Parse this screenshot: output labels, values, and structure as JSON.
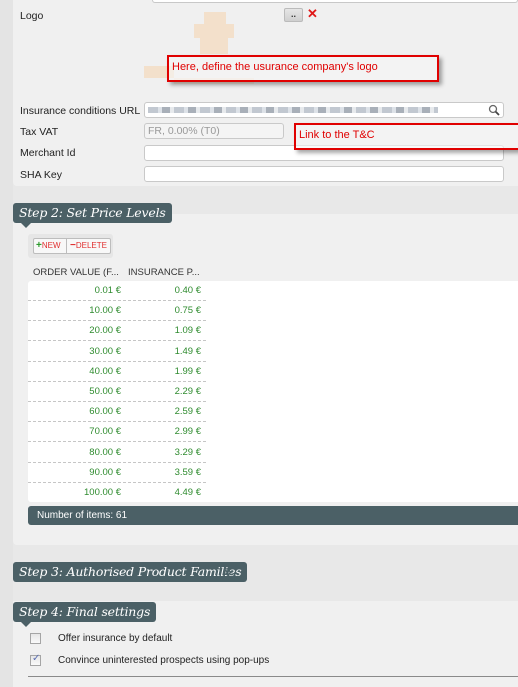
{
  "step1": {
    "logo_label": "Logo",
    "browse_label": "..",
    "remove_label": "✕",
    "insurance_url_label": "Insurance conditions URL",
    "tax_vat_label": "Tax VAT",
    "tax_vat_value": "FR, 0.00% (T0)",
    "merchant_id_label": "Merchant Id",
    "merchant_id_value": "",
    "sha_key_label": "SHA Key",
    "sha_key_value": ""
  },
  "annotations": {
    "logo_callout": "Here, define the usurance company's logo",
    "tc_callout": "Link to the T&C"
  },
  "step2": {
    "title": "Step 2: Set Price Levels",
    "new_label": "NEW",
    "delete_label": "DELETE",
    "columns": [
      "ORDER VALUE (F...",
      "INSURANCE P..."
    ],
    "rows": [
      [
        "0.01 €",
        "0.40 €"
      ],
      [
        "10.00 €",
        "0.75 €"
      ],
      [
        "20.00 €",
        "1.09 €"
      ],
      [
        "30.00 €",
        "1.49 €"
      ],
      [
        "40.00 €",
        "1.99 €"
      ],
      [
        "50.00 €",
        "2.29 €"
      ],
      [
        "60.00 €",
        "2.59 €"
      ],
      [
        "70.00 €",
        "2.99 €"
      ],
      [
        "80.00 €",
        "3.29 €"
      ],
      [
        "90.00 €",
        "3.59 €"
      ],
      [
        "100.00 €",
        "4.49 €"
      ]
    ],
    "footer": "Number of items: 61"
  },
  "step3": {
    "title": "Step 3: Authorised Product Families",
    "expand_icon": "»"
  },
  "step4": {
    "title": "Step 4: Final settings",
    "options": [
      {
        "label": "Offer insurance by default",
        "checked": false
      },
      {
        "label": "Convince uninterested prospects using pop-ups",
        "checked": true
      }
    ]
  },
  "colors": {
    "accent": "#4b6066",
    "value_green": "#2e8b2e",
    "callout_red": "#e00000"
  }
}
